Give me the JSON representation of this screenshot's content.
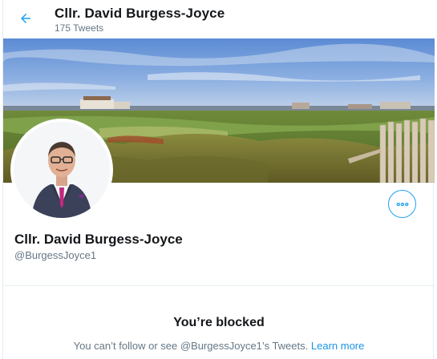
{
  "header": {
    "title": "Cllr. David Burgess-Joyce",
    "tweet_count": "175 Tweets",
    "back_icon": "arrow-left-icon"
  },
  "profile": {
    "display_name": "Cllr. David Burgess-Joyce",
    "handle": "@BurgessJoyce1",
    "more_icon": "more-dots-icon"
  },
  "blocked": {
    "title": "You’re blocked",
    "message": "You can’t follow or see @BurgessJoyce1’s Tweets.",
    "link": "Learn more"
  },
  "colors": {
    "accent": "#1da1f2",
    "link": "#1b95e0",
    "secondary_text": "#657786",
    "primary_text": "#14171a",
    "border": "#e6ecf0"
  }
}
